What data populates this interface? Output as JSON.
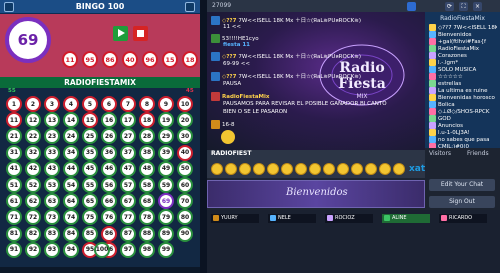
{
  "bingo": {
    "title": "BINGO 100",
    "current_number": "69",
    "recent_numbers": [
      "11",
      "95",
      "86",
      "40",
      "96",
      "15",
      "18"
    ],
    "banner": "RADIOFIESTAMIX",
    "range_low": "55",
    "range_high": "45",
    "called_numbers": [
      11,
      15,
      18,
      40,
      69,
      86,
      95,
      96,
      1,
      2,
      3,
      4,
      5,
      6,
      7,
      8,
      9,
      10
    ],
    "colors": {
      "called": "#cc1f2e",
      "open": "#2a8f3e",
      "current": "#7b2fbf",
      "accent": "#b83a5a"
    }
  },
  "chat": {
    "header_id": "27099",
    "messages": [
      {
        "name": "◇??7 ",
        "text": "7W<<ISELL 18K Mx",
        "extra": "＋日☆(ЯaL≋PUяROCK≋)"
      },
      {
        "name": "11 ",
        "text": "<<",
        "extra": ""
      },
      {
        "name": "53!!!!HE1cyo",
        "text": "",
        "extra": ""
      },
      {
        "name": "fiesta 11",
        "text": "",
        "extra": ""
      },
      {
        "name": "◇??7 ",
        "text": "7W<<ISELL 18K Mx",
        "extra": "＋日☆(ЯaL≋PUяROCK≋)"
      },
      {
        "name": "69-99",
        "text": "<<",
        "extra": ""
      },
      {
        "name": "◇??7 ",
        "text": "7W<<ISELL 18K Mx",
        "extra": "＋日☆(ЯaL≋PUяROCK≋)"
      },
      {
        "name": "PAUSA",
        "text": "",
        "extra": ""
      },
      {
        "name": "RadioFiestaMix",
        "text": "",
        "extra": ""
      },
      {
        "name": "PAUSAMOS PARA REVISAR",
        "text": "EL POSIBLE GANADOR BI CANTO",
        "extra": ""
      },
      {
        "name": "BIEN O SE LE PASARON",
        "text": "",
        "extra": ""
      },
      {
        "name": "16-8",
        "text": "",
        "extra": ""
      }
    ],
    "radio_label": "RADIOFIEST",
    "xat": "xat",
    "input_text": "Bienvenidos",
    "edit_chat": "Edit Your Chat",
    "sign_out": "Sign Out",
    "tab_visitors": "Visitors",
    "tab_friends": "Friends",
    "users_title": "RadioFiestaMix",
    "users": [
      "◇??7 7W<<ISELL 18K Mx",
      "Bienvenidos",
      "+gal(ftlhvi#Fas{f",
      "RadioFiestaMix",
      "Corazones",
      "l.-.lgm*",
      "SOLO MUSICA",
      "☆☆☆☆☆",
      "estrellas",
      "La ultima es ruine",
      "Bienvenidas horosco",
      "Bolica",
      "◇⊥Ø◇/SHOS-RPCK",
      "GOD",
      "Anuncios",
      "l.u-1-0LJ3A!",
      "no sabes que pasa",
      "CMIL:)#0(0"
    ],
    "footer_slots": [
      "YUURY",
      "NELE",
      "ROCIOZ",
      "ALINE",
      "RICARDO"
    ]
  }
}
